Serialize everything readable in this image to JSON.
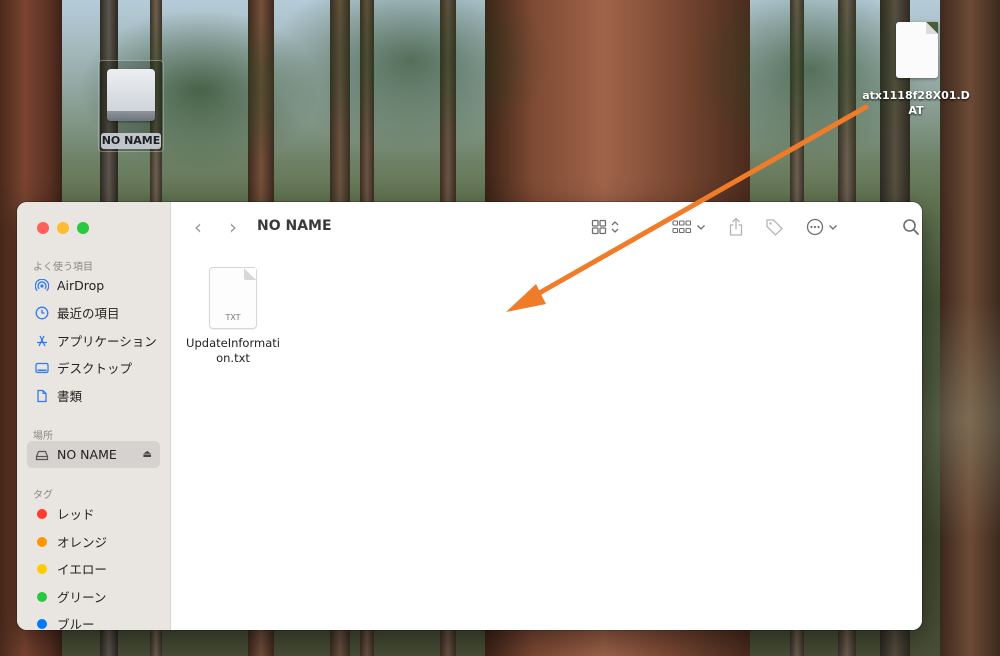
{
  "desktop": {
    "drive_label": "NO NAME",
    "dat_file_name": "atx1118f28X01.DAT"
  },
  "finder": {
    "title": "NO NAME",
    "sidebar": {
      "favorites_heading": "よく使う項目",
      "favorites": [
        {
          "label": "AirDrop",
          "icon": "airdrop-icon"
        },
        {
          "label": "最近の項目",
          "icon": "clock-icon"
        },
        {
          "label": "アプリケーション",
          "icon": "applications-icon"
        },
        {
          "label": "デスクトップ",
          "icon": "desktop-icon"
        },
        {
          "label": "書類",
          "icon": "document-icon"
        }
      ],
      "locations_heading": "場所",
      "locations": [
        {
          "label": "NO NAME",
          "icon": "external-drive-icon",
          "selected": true
        }
      ],
      "tags_heading": "タグ",
      "tags": [
        {
          "label": "レッド",
          "color": "#ff3b30"
        },
        {
          "label": "オレンジ",
          "color": "#ff9500"
        },
        {
          "label": "イエロー",
          "color": "#ffcc00"
        },
        {
          "label": "グリーン",
          "color": "#28c840"
        },
        {
          "label": "ブルー",
          "color": "#007aff"
        }
      ]
    },
    "files": [
      {
        "name": "UpdateInformation.txt",
        "type_label": "TXT"
      }
    ]
  },
  "annotation": {
    "arrow_color": "#f07c2a"
  }
}
